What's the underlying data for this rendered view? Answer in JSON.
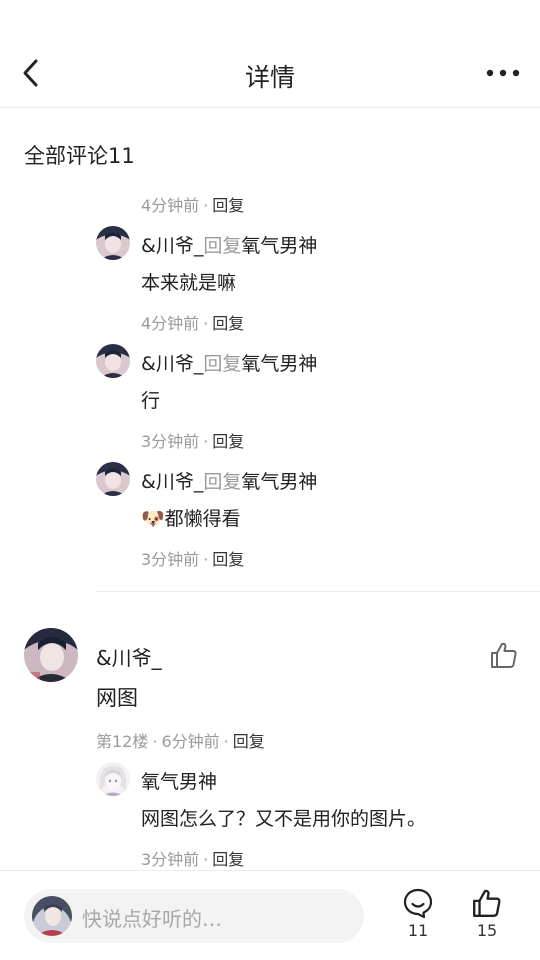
{
  "header": {
    "title": "详情",
    "back_icon": "chevron-left-icon",
    "more_icon": "more-horizontal-icon"
  },
  "section": {
    "title": "全部评论11"
  },
  "top_meta": {
    "time": "4分钟前",
    "reply": "回复"
  },
  "replies": [
    {
      "name": "&川爷_",
      "reply_word": "回复",
      "target": "氧气男神",
      "text": "本来就是嘛",
      "time": "4分钟前",
      "reply": "回复"
    },
    {
      "name": "&川爷_",
      "reply_word": "回复",
      "target": "氧气男神",
      "text": "行",
      "time": "3分钟前",
      "reply": "回复"
    },
    {
      "name": "&川爷_",
      "reply_word": "回复",
      "target": "氧气男神",
      "emoji": "🐶",
      "text": "都懒得看",
      "time": "3分钟前",
      "reply": "回复"
    }
  ],
  "main_comment": {
    "name": "&川爷_",
    "text": "网图",
    "floor": "第12楼",
    "time": "6分钟前",
    "reply": "回复",
    "like_icon": "thumbs-up-icon",
    "sub_reply": {
      "name": "氧气男神",
      "text": "网图怎么了？又不是用你的图片。",
      "time": "3分钟前",
      "reply": "回复"
    }
  },
  "bottom_bar": {
    "placeholder": "快说点好听的…",
    "comment_count": "11",
    "like_count": "15",
    "comment_icon": "comment-bubble-icon",
    "like_icon": "thumbs-up-icon"
  },
  "colors": {
    "text": "#222222",
    "muted": "#9a9a9a",
    "divider": "#ececec",
    "input_bg": "#f3f3f3"
  }
}
